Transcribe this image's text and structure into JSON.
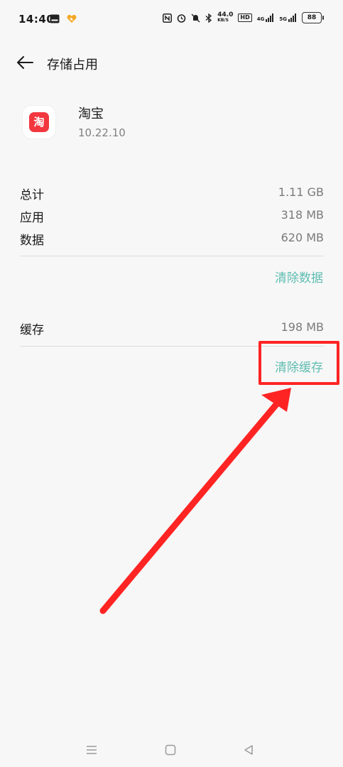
{
  "status_bar": {
    "time": "14:40",
    "net_speed": "44.0",
    "net_speed_unit": "KB/S",
    "hd_label": "HD",
    "sim1_label": "4G",
    "sim2_label": "5G",
    "battery": "88"
  },
  "header": {
    "title": "存储占用"
  },
  "app": {
    "name": "淘宝",
    "icon_char": "淘",
    "version": "10.22.10",
    "icon_color": "#f2373f"
  },
  "storage": {
    "rows": [
      {
        "label": "总计",
        "value": "1.11 GB"
      },
      {
        "label": "应用",
        "value": "318 MB"
      },
      {
        "label": "数据",
        "value": "620 MB"
      }
    ],
    "clear_data_label": "清除数据"
  },
  "cache": {
    "label": "缓存",
    "value": "198 MB",
    "clear_cache_label": "清除缓存"
  },
  "colors": {
    "accent": "#5fbdb0",
    "annotation": "#ff2424"
  }
}
